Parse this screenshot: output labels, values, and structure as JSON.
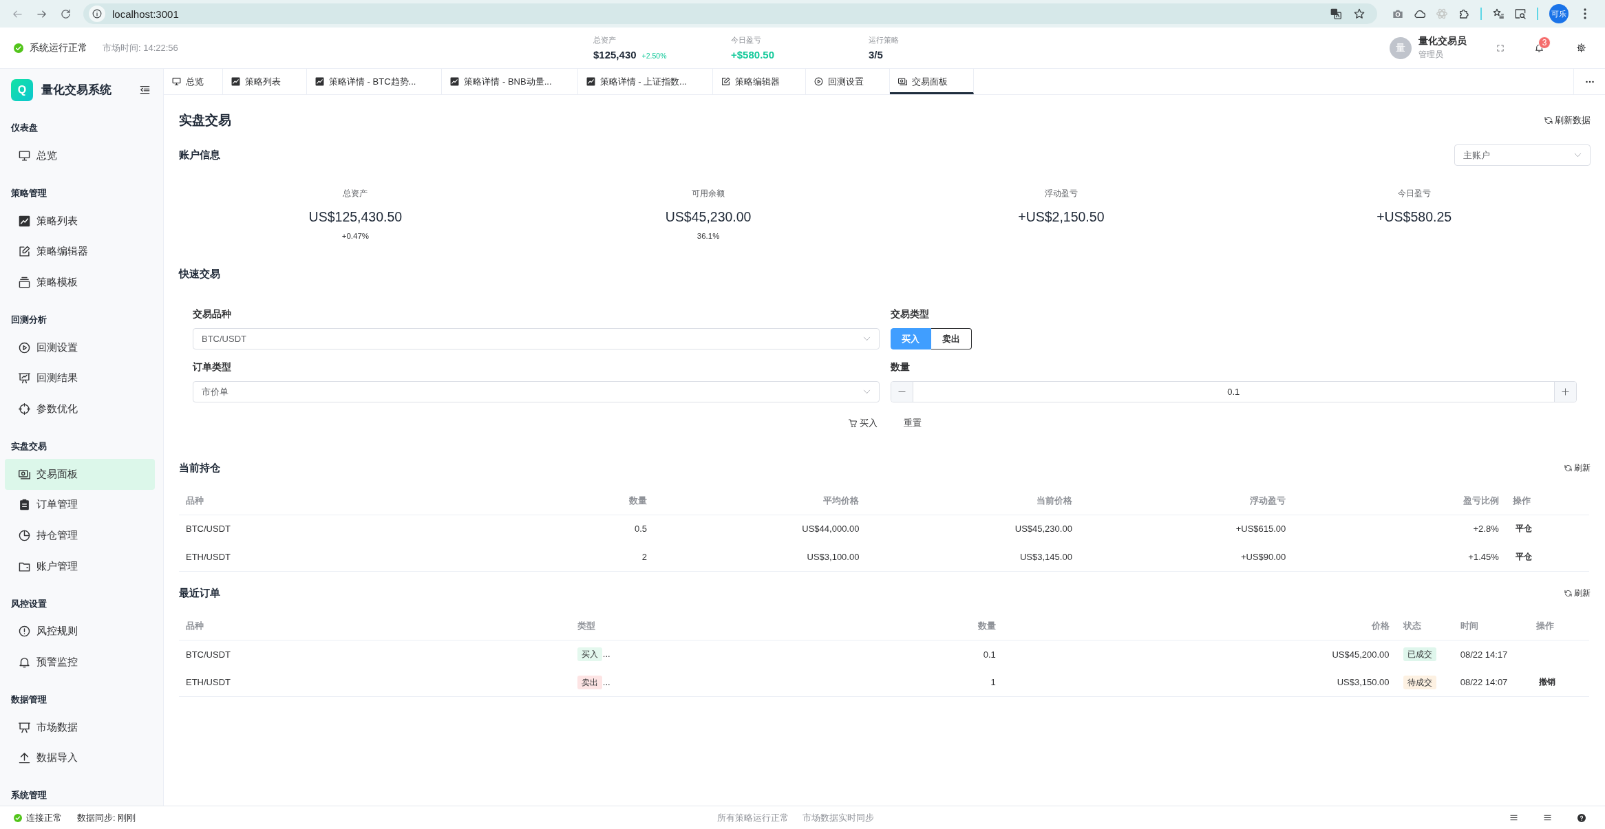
{
  "browser": {
    "url": "localhost:3001",
    "profile": "可乐"
  },
  "header": {
    "status": "系统运行正常",
    "market_time": "市场时间: 14:22:56",
    "stats": [
      {
        "label": "总资产",
        "value": "$125,430",
        "change": "+2.50%",
        "highlight": false
      },
      {
        "label": "今日盈亏",
        "value": "+$580.50",
        "highlight": true
      },
      {
        "label": "运行策略",
        "value": "3/5",
        "highlight": false
      }
    ],
    "user": {
      "avatar": "量",
      "name": "量化交易员",
      "role": "管理员"
    },
    "notifications": "3"
  },
  "sidebar": {
    "logo": "Q",
    "title": "量化交易系统",
    "groups": [
      {
        "heading": "仪表盘",
        "items": [
          {
            "label": "总览",
            "selected": false
          }
        ]
      },
      {
        "heading": "策略管理",
        "items": [
          {
            "label": "策略列表",
            "selected": false
          },
          {
            "label": "策略编辑器",
            "selected": false
          },
          {
            "label": "策略模板",
            "selected": false
          }
        ]
      },
      {
        "heading": "回测分析",
        "items": [
          {
            "label": "回测设置",
            "selected": false
          },
          {
            "label": "回测结果",
            "selected": false
          },
          {
            "label": "参数优化",
            "selected": false
          }
        ]
      },
      {
        "heading": "实盘交易",
        "items": [
          {
            "label": "交易面板",
            "selected": true
          },
          {
            "label": "订单管理",
            "selected": false
          },
          {
            "label": "持仓管理",
            "selected": false
          },
          {
            "label": "账户管理",
            "selected": false
          }
        ]
      },
      {
        "heading": "风控设置",
        "items": [
          {
            "label": "风控规则",
            "selected": false
          },
          {
            "label": "预警监控",
            "selected": false
          }
        ]
      },
      {
        "heading": "数据管理",
        "items": [
          {
            "label": "市场数据",
            "selected": false
          },
          {
            "label": "数据导入",
            "selected": false
          }
        ]
      },
      {
        "heading": "系统管理"
      }
    ]
  },
  "tabs": [
    {
      "label": "总览",
      "selected": false
    },
    {
      "label": "策略列表",
      "selected": false
    },
    {
      "label": "策略详情 - BTC趋势...",
      "selected": false
    },
    {
      "label": "策略详情 - BNB动量...",
      "selected": false
    },
    {
      "label": "策略详情 - 上证指数...",
      "selected": false
    },
    {
      "label": "策略编辑器",
      "selected": false
    },
    {
      "label": "回测设置",
      "selected": false
    },
    {
      "label": "交易面板",
      "selected": true
    }
  ],
  "page": {
    "title": "实盘交易",
    "refresh": "刷新数据"
  },
  "account": {
    "heading": "账户信息",
    "selector": "主账户",
    "stats": [
      {
        "label": "总资产",
        "value": "US$125,430.50",
        "sub": "+0.47%"
      },
      {
        "label": "可用余额",
        "value": "US$45,230.00",
        "sub": "36.1%"
      },
      {
        "label": "浮动盈亏",
        "value": "+US$2,150.50"
      },
      {
        "label": "今日盈亏",
        "value": "+US$580.25"
      }
    ]
  },
  "quick_trade": {
    "heading": "快速交易",
    "symbol": {
      "label": "交易品种",
      "value": "BTC/USDT"
    },
    "side": {
      "label": "交易类型",
      "options": [
        {
          "label": "买入",
          "selected": true
        },
        {
          "label": "卖出",
          "selected": false
        }
      ]
    },
    "order_type": {
      "label": "订单类型",
      "value": "市价单"
    },
    "quantity": {
      "label": "数量",
      "value": "0.1"
    },
    "actions": [
      {
        "kind": "submit",
        "label": "买入"
      },
      {
        "kind": "reset",
        "label": "重置"
      }
    ]
  },
  "positions": {
    "heading": "当前持仓",
    "refresh": "刷新",
    "columns": [
      "品种",
      "数量",
      "平均价格",
      "当前价格",
      "浮动盈亏",
      "盈亏比例",
      "操作"
    ],
    "rows": [
      {
        "symbol": "BTC/USDT",
        "quantity": "0.5",
        "avg_price": "US$44,000.00",
        "current_price": "US$45,230.00",
        "pnl": "+US$615.00",
        "pnl_ratio": "+2.8%",
        "action": "平仓"
      },
      {
        "symbol": "ETH/USDT",
        "quantity": "2",
        "avg_price": "US$3,100.00",
        "current_price": "US$3,145.00",
        "pnl": "+US$90.00",
        "pnl_ratio": "+1.45%",
        "action": "平仓"
      }
    ]
  },
  "orders": {
    "heading": "最近订单",
    "refresh": "刷新",
    "columns": [
      "品种",
      "类型",
      "数量",
      "价格",
      "状态",
      "时间",
      "操作"
    ],
    "rows": [
      {
        "symbol": "BTC/USDT",
        "type_tag": {
          "text": "买入",
          "color": "#e4f8ee"
        },
        "type_more": "...",
        "quantity": "0.1",
        "price": "US$45,200.00",
        "status_tag": {
          "text": "已成交",
          "color": "#dff6ec"
        },
        "time": "08/22 14:17"
      },
      {
        "symbol": "ETH/USDT",
        "type_tag": {
          "text": "卖出",
          "color": "#fde4e4"
        },
        "type_more": "...",
        "quantity": "1",
        "price": "US$3,150.00",
        "status_tag": {
          "text": "待成交",
          "color": "#fdf1e2"
        },
        "time": "08/22 14:07",
        "action": "撤销"
      }
    ]
  },
  "status_bar": {
    "connection": "连接正常",
    "sync": "数据同步: 刚刚",
    "messages": [
      "所有策略运行正常",
      "市场数据实时同步"
    ]
  }
}
